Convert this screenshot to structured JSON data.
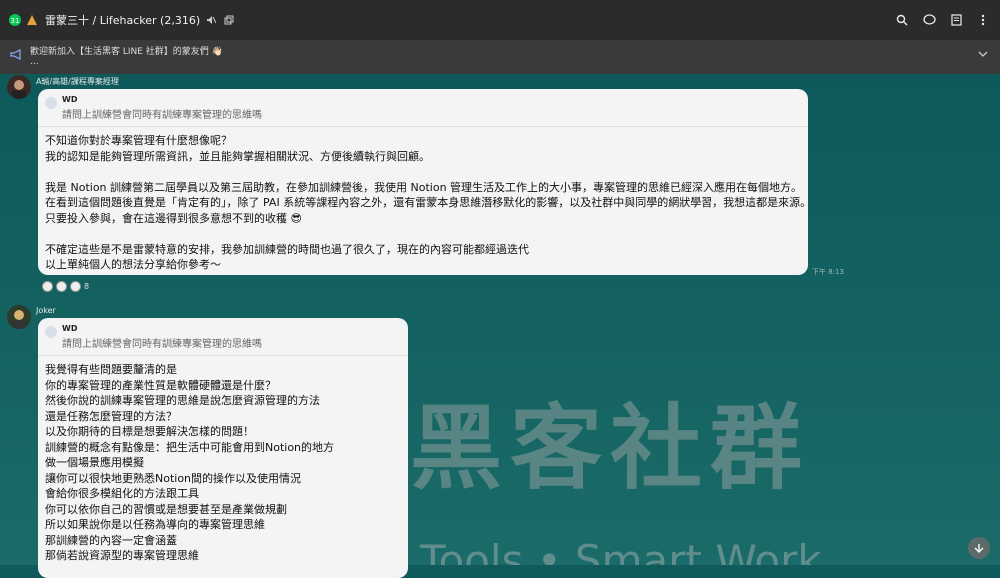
{
  "header": {
    "title": "雷蒙三十 / Lifehacker (2,316)",
    "icons": [
      "app-badge-icon",
      "mute-icon",
      "external-window-icon",
      "search-icon",
      "chat-icon",
      "notes-icon",
      "more-icon"
    ]
  },
  "announcement": {
    "text": "歡迎新加入【生活黑客 LINE 社群】的蒙友們 👋🏻",
    "ellipsis": "..."
  },
  "background": {
    "title": "黑客社群",
    "subtitle": "Tools • Smart Work"
  },
  "messages": [
    {
      "sender": "A瑜/高雄/課程專案經理",
      "quote": {
        "name": "WD",
        "text": "請問上訓練營會同時有訓練專案管理的思維嗎"
      },
      "lines": [
        "不知道你對於專案管理有什麼想像呢？",
        "我的認知是能夠管理所需資訊，並且能夠掌握相關狀況、方便後續執行與回顧。",
        "",
        "我是 Notion 訓練營第二屆學員以及第三屆助教，在參加訓練營後，我使用 Notion 管理生活及工作上的大小事，專案管理的思維已經深入應用在每個地方。",
        "在看到這個問題後直覺是「肯定有的」，除了 PAI 系統等課程內容之外，還有雷蒙本身思維潛移默化的影響，以及社群中與同學的網狀學習，我想這都是來源。",
        "只要投入參與，會在這邊得到很多意想不到的收穫 😎",
        "",
        "不確定這些是不是雷蒙特意的安排，我參加訓練營的時間也過了很久了，現在的內容可能都經過迭代",
        "以上單純個人的想法分享給你參考～"
      ],
      "time": "下午 8:13",
      "reaction_count": "8"
    },
    {
      "sender": "Joker",
      "quote": {
        "name": "WD",
        "text": "請問上訓練營會同時有訓練專案管理的思維嗎"
      },
      "lines": [
        "我覺得有些問題要釐清的是",
        "你的專案管理的產業性質是軟體硬體還是什麼？",
        "然後你說的訓練專案管理的思維是說怎麼資源管理的方法",
        "還是任務怎麼管理的方法？",
        "以及你期待的目標是想要解決怎樣的問題！",
        "訓練營的概念有點像是：把生活中可能會用到Notion的地方",
        "做一個場景應用模擬",
        "讓你可以很快地更熟悉Notion間的操作以及使用情況",
        "會給你很多模組化的方法跟工具",
        "你可以依你自己的習慣或是想要甚至是產業做規劃",
        "所以如果說你是以任務為導向的專案管理思維",
        "那訓練營的內容一定會涵蓋",
        "那倘若說資源型的專案管理思維"
      ]
    }
  ]
}
